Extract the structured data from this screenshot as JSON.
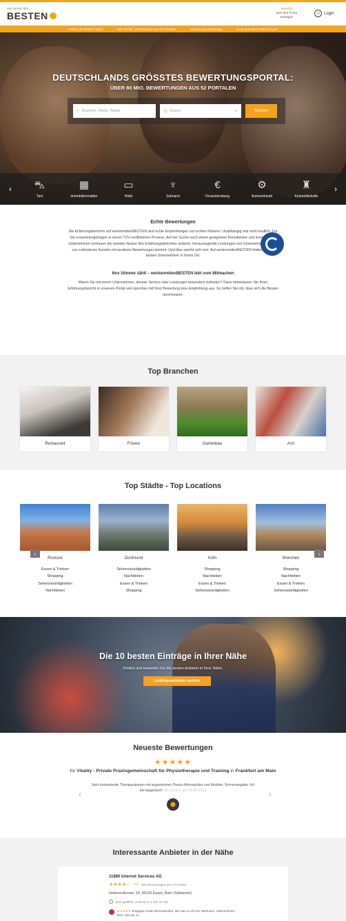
{
  "header": {
    "logo_top": "wer kennt den",
    "logo_main": "BESTEN",
    "cta_gratis": "GRATIS",
    "cta_line1": "jetzt Ihre Firma",
    "cta_line2": "eintragen",
    "login_label": "Login"
  },
  "promo_bar": [
    "Einfach die Besten finden",
    "über 80 Mio. Bewertungen aus 52 Portalen",
    "neutral und unabhängig",
    "keine gekauften Platzierungen"
  ],
  "hero": {
    "title": "DEUTSCHLANDS GRÖSSTES BEWERTUNGSPORTAL:",
    "subtitle": "ÜBER 80 MIO. BEWERTUNGEN AUS 52 PORTALEN",
    "search_placeholder": "Branche, Firma, Name",
    "location_value": "Essen",
    "search_button": "Suchen",
    "categories": [
      {
        "label": "Taxi",
        "icon": "taxi-icon"
      },
      {
        "label": "Immobilienmakler",
        "icon": "building-icon"
      },
      {
        "label": "Hotel",
        "icon": "bed-icon"
      },
      {
        "label": "Zahnarzt",
        "icon": "tooth-icon"
      },
      {
        "label": "Finanzberatung",
        "icon": "euro-icon"
      },
      {
        "label": "Autowerkstatt",
        "icon": "car-repair-icon"
      },
      {
        "label": "Kosmetikstudio",
        "icon": "cosmetics-icon"
      }
    ]
  },
  "echte": {
    "title": "Echte Bewertungen",
    "p1": "Die Erfahrungsberichte auf werkenntdenBESTEN sind echte Empfehlungen von echten Nutzern. Unabhängig und nicht käuflich. Für Sie zusammengetragen in einem TÜV-zertifizierten Prozess. Auf der Suche nach einem geeigneten Dienstleister und kompetenten Unternehmen vertrauen die meisten Nutzer den Erfahrungsberichten anderer. Herausragende Leistungen von Unternehmen werden von zufriedenen Kunden mit positiven Bewertungen belohnt. Und dies spricht sich rum. Auf werkenntdenBESTEN finden Sie die besten Unternehmen in Ihrem Ort.",
    "subtitle": "Ihre Stimme zählt – werkenntdenBESTEN lebt vom Mitmachen",
    "p2": "Waren Sie mit einem Unternehmen, dessen Service oder Leistungen besonders zufrieden? Dann hinterlassen Sie Ihren Erfahrungsbericht in unserem Portal und sprechen mit Ihrer Bewertung eine Empfehlung aus. So helfen Sie mit, dass sich die Besten durchsetzen."
  },
  "branchen": {
    "title": "Top Branchen",
    "items": [
      "Restaurant",
      "Friseur",
      "Gartenbau",
      "Arzt"
    ]
  },
  "staedte": {
    "title": "Top Städte - Top Locations",
    "cities": [
      {
        "name": "Rostock",
        "tags": [
          "Essen & Trinken",
          "Shopping",
          "Sehenswürdigkeiten",
          "Nachtleben"
        ]
      },
      {
        "name": "Dortmund",
        "tags": [
          "Sehenswürdigkeiten",
          "Nachtleben",
          "Essen & Trinken",
          "Shopping"
        ]
      },
      {
        "name": "Köln",
        "tags": [
          "Shopping",
          "Nachtleben",
          "Essen & Trinken",
          "Sehenswürdigkeiten"
        ]
      },
      {
        "name": "München",
        "tags": [
          "Shopping",
          "Nachtleben",
          "Essen & Trinken",
          "Sehenswürdigkeiten"
        ]
      }
    ]
  },
  "promo": {
    "title": "Die 10 besten Einträge in Ihrer Nähe",
    "subtitle": "Finden und bewerten Sie die besten Anbieter in Ihrer Nähe.",
    "button": "Lieblingsanbieter suchen"
  },
  "neueste": {
    "title": "Neueste Bewertungen",
    "stars": "★★★★★",
    "for": "für",
    "company": "Vitality - Private Praxisgemeinschaft für Physiotherapie und Training",
    "in": "in",
    "city": "Frankfurt am Main",
    "text": "Sehr kompetente Therapeutinnen mit angenehmer Praxis-Atmosphäre und flexibler Terminvergabe: Ich bin begeistert!",
    "meta": "von Cora T. am 05.04.2019"
  },
  "anbieter": {
    "title": "Interessante Anbieter in der Nähe",
    "name": "11880 Internet Services AG",
    "stars": "★★★★☆",
    "grade": "Gut",
    "count": "258 Bewertungen aus 3 Portalen",
    "address": "Hohenzollernstr. 24, 45128 Essen, Ruhr (Südviertel)",
    "open": "jetzt geöffnet, schließt in 6 Std. 37 Min.",
    "quote_stars": "★★★★★",
    "quote": "Entgegen vieler Beschwerden, die man so oft von Telefonen, Unternehmen liest, sind wir zu"
  },
  "colors": {
    "accent": "#f5a21c"
  }
}
